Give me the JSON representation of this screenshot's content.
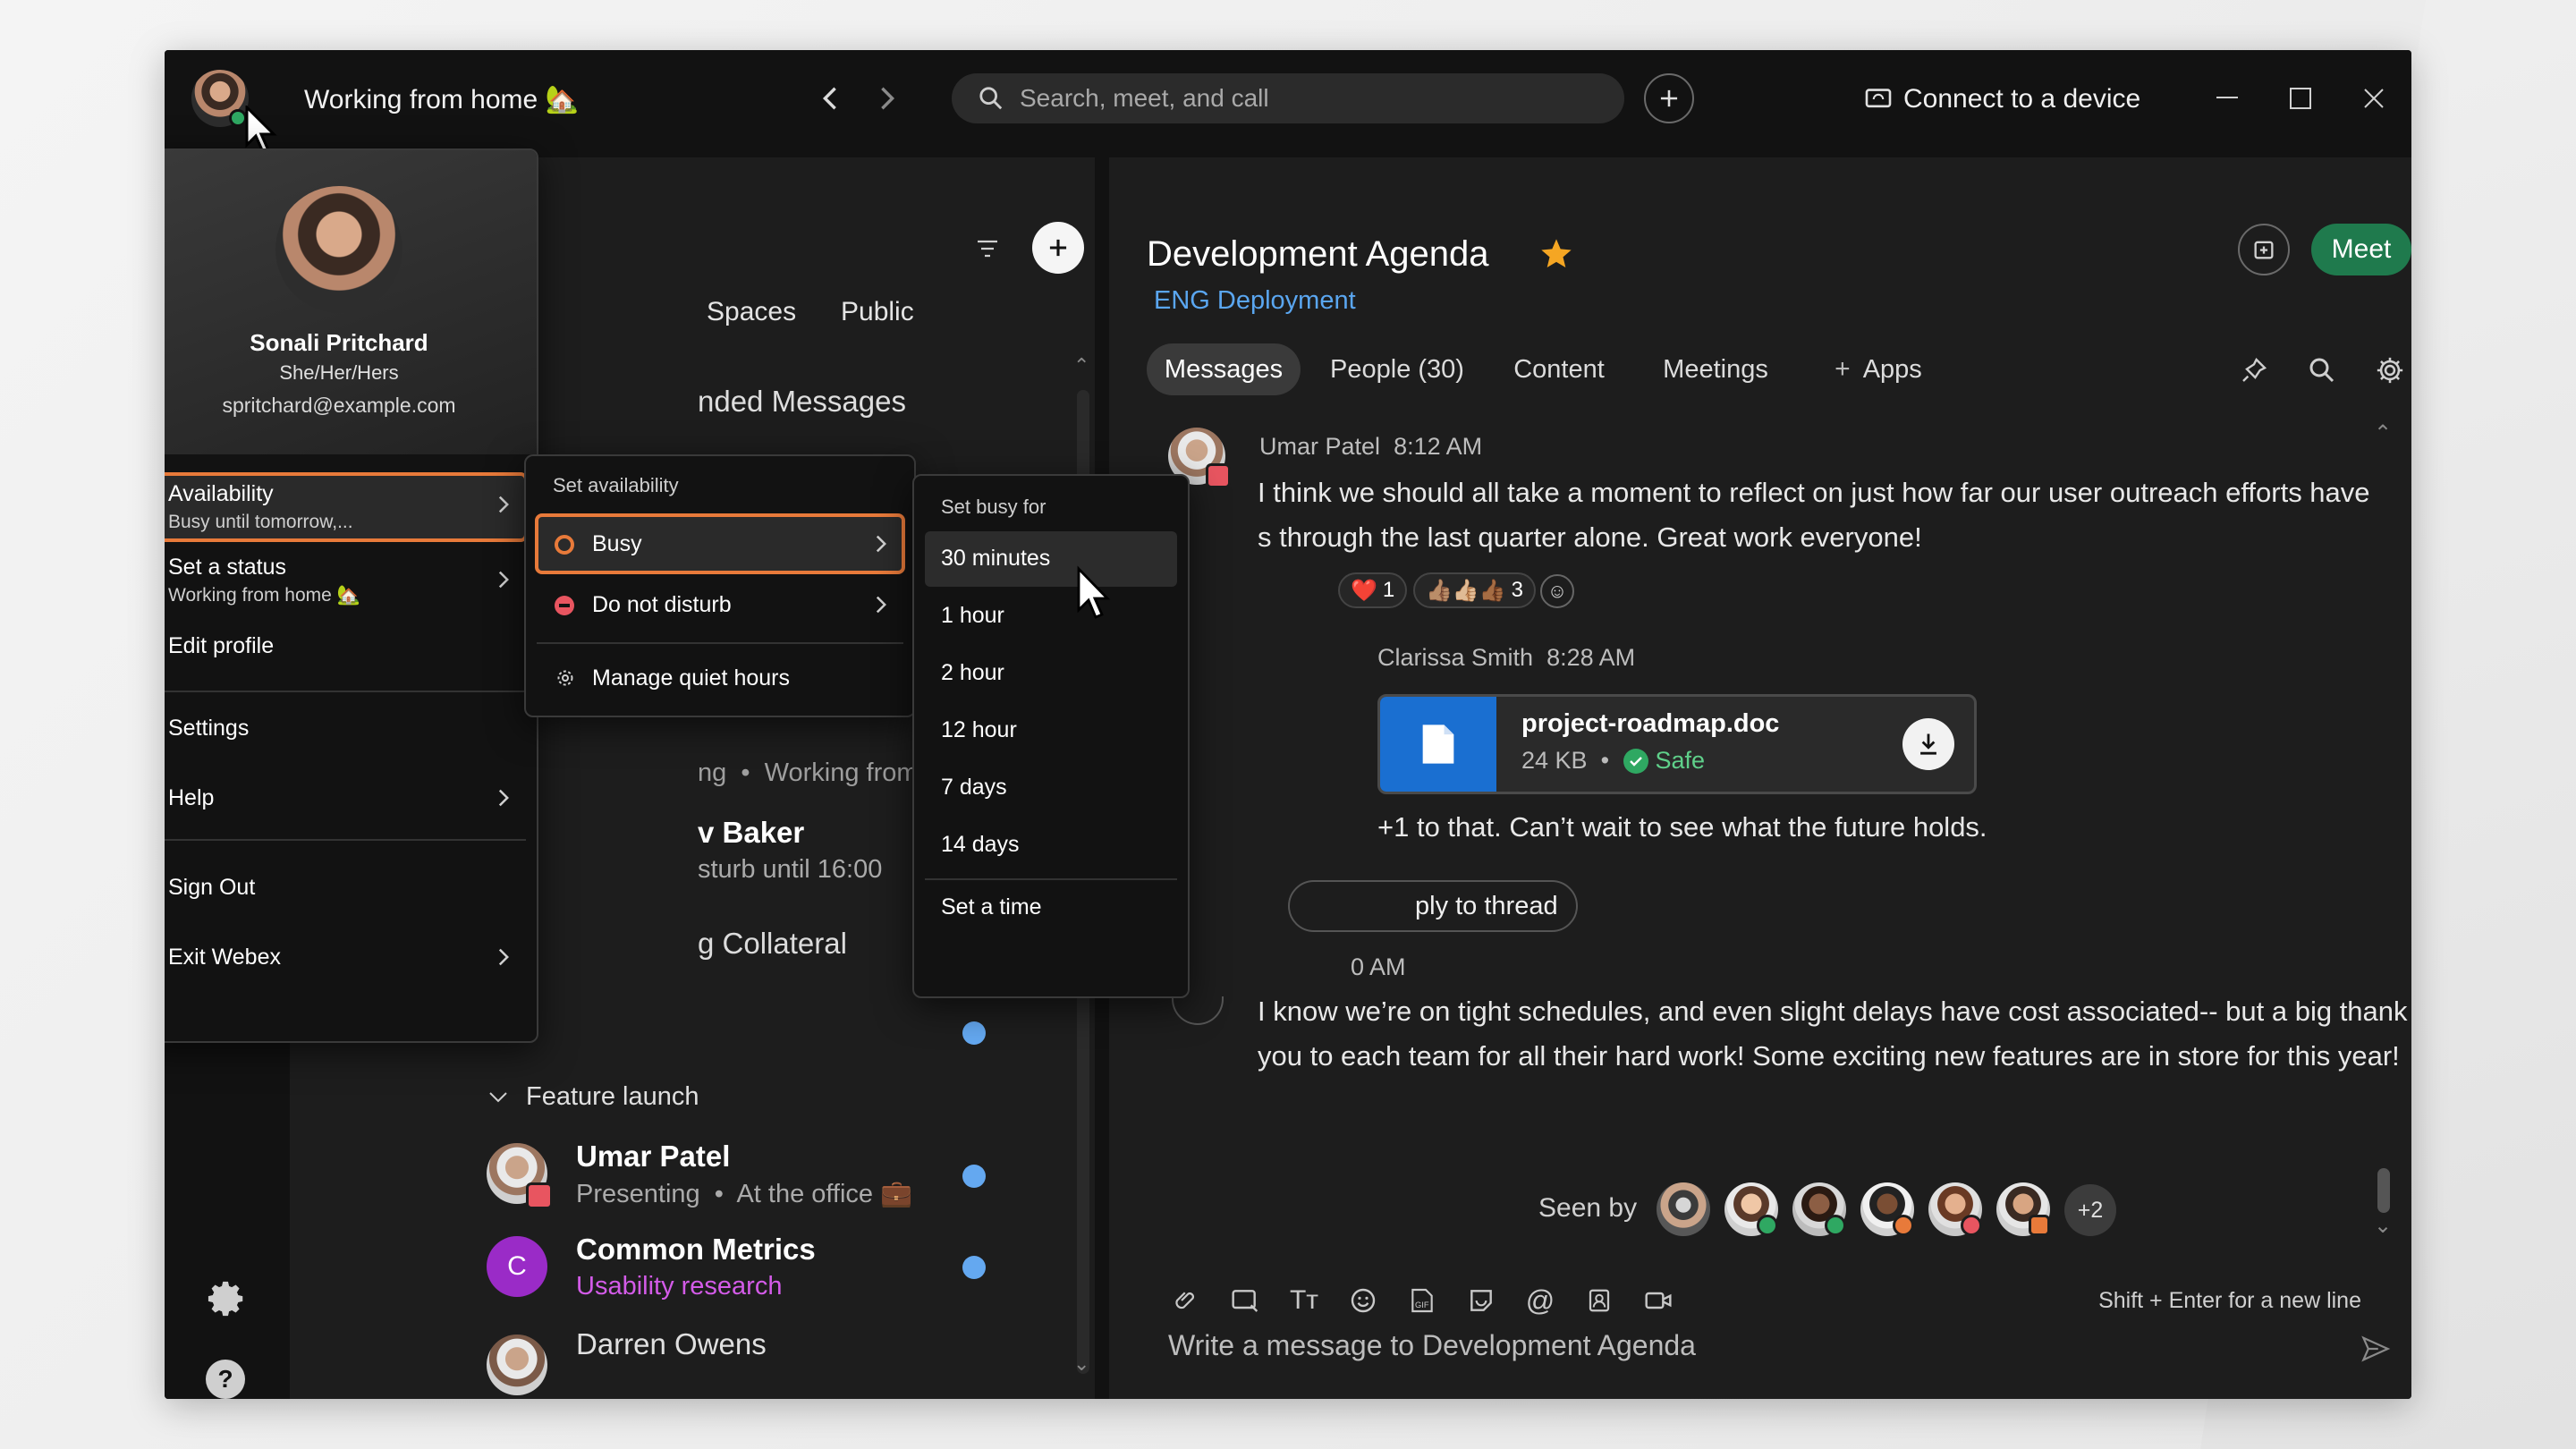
{
  "app": {
    "status_title": "Working from home 🏡",
    "search_placeholder": "Search, meet, and call",
    "connect_device": "Connect to a device"
  },
  "profile": {
    "name": "Sonali Pritchard",
    "pronouns": "She/Her/Hers",
    "email": "spritchard@example.com"
  },
  "profile_menu": {
    "availability_label": "Availability",
    "availability_sub": "Busy until tomorrow,...",
    "set_status_label": "Set a status",
    "set_status_sub": "Working from home 🏡",
    "edit_profile": "Edit profile",
    "settings": "Settings",
    "help": "Help",
    "sign_out": "Sign Out",
    "exit": "Exit Webex"
  },
  "availability_menu": {
    "header": "Set availability",
    "busy": "Busy",
    "dnd": "Do not disturb",
    "quiet_hours": "Manage quiet hours"
  },
  "busy_menu": {
    "header": "Set busy for",
    "options": [
      "30 minutes",
      "1 hour",
      "2 hour",
      "12 hour",
      "7 days",
      "14 days"
    ],
    "set_time": "Set a time"
  },
  "list": {
    "filter_spaces": "Spaces",
    "filter_public": "Public",
    "partial_recommended": "nded Messages",
    "partial_status1": "ng",
    "partial_status1b": "Working from home",
    "partial_baker_name": "v Baker",
    "partial_baker_sub": "sturb until 16:00",
    "partial_collateral": "g Collateral",
    "section_feature": "Feature launch",
    "items": [
      {
        "name": "Umar Patel",
        "sub1": "Presenting",
        "sub2": "At the office 💼"
      },
      {
        "name": "Common Metrics",
        "sub1": "Usability research",
        "initial": "C"
      },
      {
        "name": "Darren Owens"
      }
    ]
  },
  "space": {
    "title": "Development Agenda",
    "team": "ENG Deployment",
    "meet_label": "Meet",
    "tabs": [
      "Messages",
      "People (30)",
      "Content",
      "Meetings",
      "Apps"
    ],
    "messages": [
      {
        "author": "Umar Patel",
        "time": "8:12 AM",
        "line1": "I think we should all take a moment to reflect on just how far our user outreach efforts have",
        "line2": "s through the last quarter alone. Great work everyone!"
      },
      {
        "author": "Clarissa Smith",
        "time": "8:28 AM",
        "text": "+1 to that. Can’t wait to see what the future holds."
      },
      {
        "time_partial": "0 AM",
        "line1": "I know we’re on tight schedules, and even slight delays have cost associated-- but a big thank",
        "line2": "you to each team for all their hard work! Some exciting new features are in store for this year!"
      }
    ],
    "reactions": [
      {
        "emoji": "❤️",
        "count": "1"
      },
      {
        "emoji": "👍🏽👍🏼👍🏾",
        "count": "3"
      }
    ],
    "file": {
      "name": "project-roadmap.doc",
      "size": "24 KB",
      "safe": "Safe"
    },
    "reply_thread": "ply to thread",
    "seen_by": "Seen by",
    "seen_more": "+2",
    "composer_placeholder": "Write a message to Development Agenda",
    "composer_hint": "Shift + Enter for a new line"
  },
  "colors": {
    "accent_green": "#1f7a4d",
    "busy_orange": "#e87a3a",
    "link_blue": "#5aa6f0",
    "dnd_red": "#e85560",
    "purple": "#9a2bc7",
    "star": "#f5a623"
  }
}
